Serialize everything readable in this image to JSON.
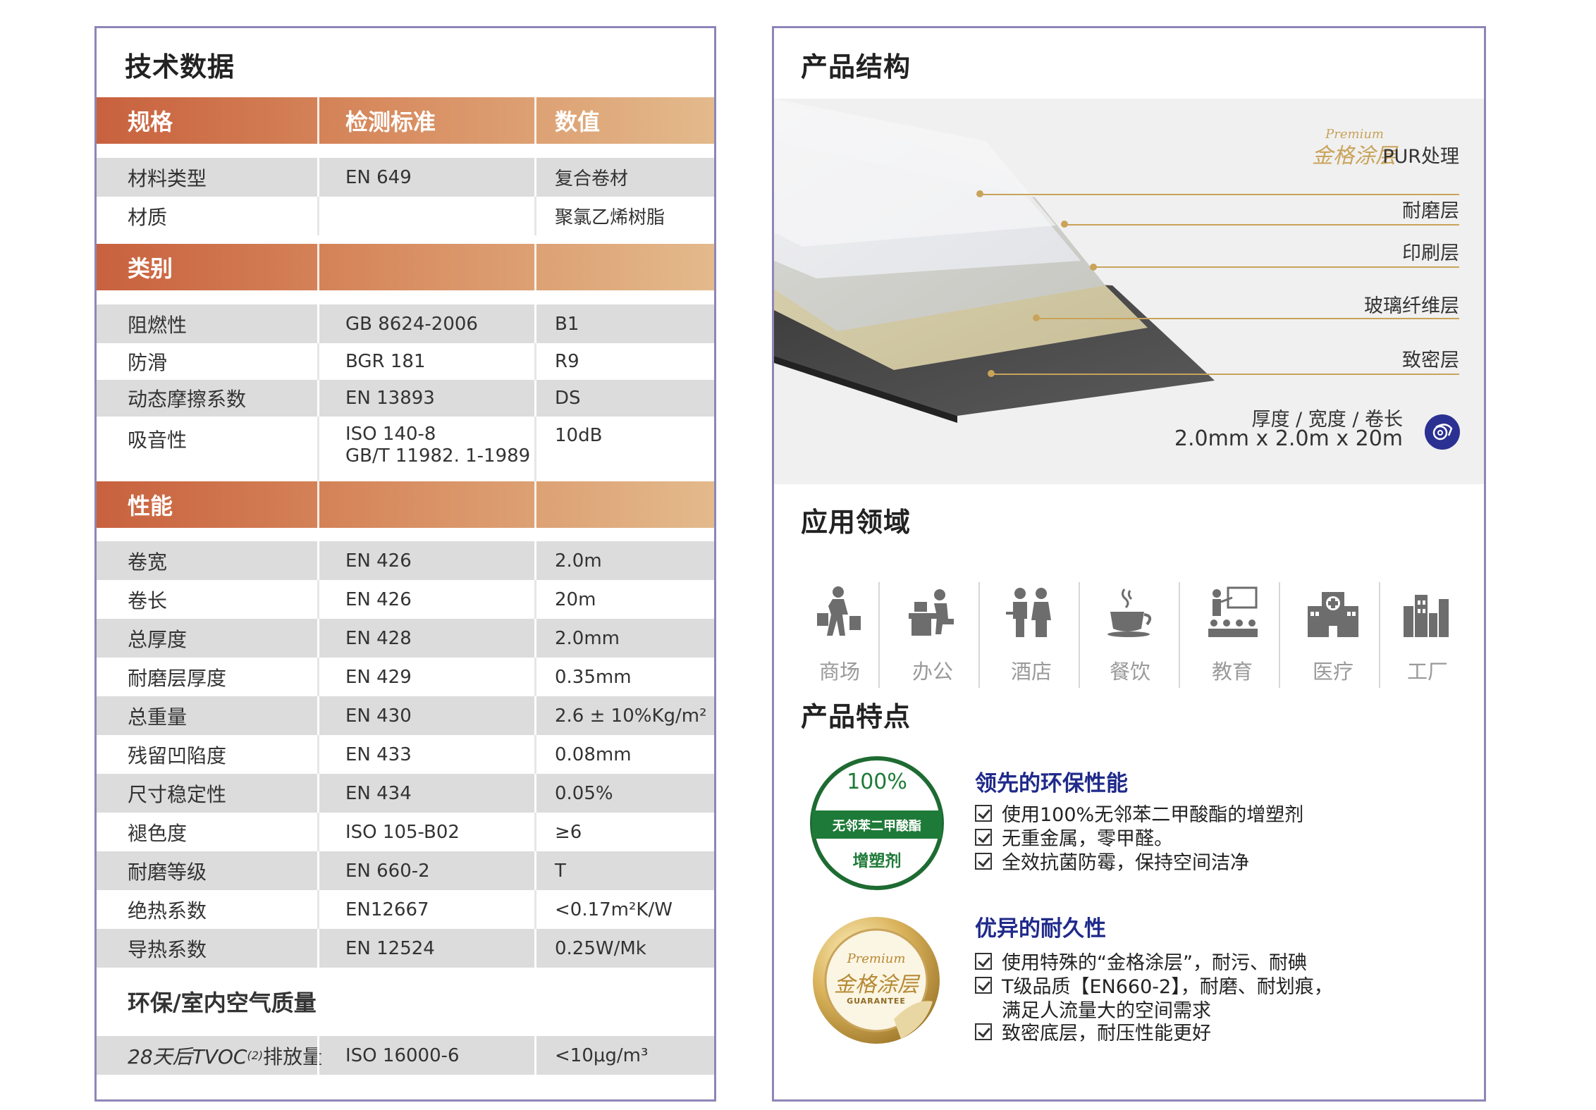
{
  "tech": {
    "title": "技术数据",
    "headers": {
      "spec": "规格",
      "standard": "检测标准",
      "value": "数值"
    },
    "group1": [
      {
        "name": "材料类型",
        "std": "EN 649",
        "val": "复合卷材"
      },
      {
        "name": "材质",
        "std": "",
        "val": "聚氯乙烯树脂"
      }
    ],
    "cat_label": "类别",
    "group2": [
      {
        "name": "阻燃性",
        "std": "GB 8624-2006",
        "val": "B1"
      },
      {
        "name": "防滑",
        "std": "BGR 181",
        "val": "R9"
      },
      {
        "name": "动态摩擦系数",
        "std": "EN 13893",
        "val": "DS"
      },
      {
        "name": "吸音性",
        "std": "ISO 140-8",
        "std2": "GB/T 11982. 1-1989",
        "val": "10dB"
      }
    ],
    "perf_label": "性能",
    "group3": [
      {
        "name": "卷宽",
        "std": "EN 426",
        "val": "2.0m"
      },
      {
        "name": "卷长",
        "std": "EN 426",
        "val": "20m"
      },
      {
        "name": "总厚度",
        "std": "EN 428",
        "val": "2.0mm"
      },
      {
        "name": "耐磨层厚度",
        "std": "EN 429",
        "val": "0.35mm"
      },
      {
        "name": "总重量",
        "std": "EN 430",
        "val": "2.6 ± 10%Kg/m²"
      },
      {
        "name": "残留凹陷度",
        "std": "EN 433",
        "val": "0.08mm"
      },
      {
        "name": "尺寸稳定性",
        "std": "EN 434",
        "val": "0.05%"
      },
      {
        "name": "褪色度",
        "std": "ISO 105-B02",
        "val": "≥6"
      },
      {
        "name": "耐磨等级",
        "std": "EN 660-2",
        "val": "T"
      },
      {
        "name": "绝热系数",
        "std": "EN12667",
        "val": "<0.17m²K/W"
      },
      {
        "name": "导热系数",
        "std": "EN 12524",
        "val": "0.25W/Mk"
      }
    ],
    "env_label": "环保/室内空气质量",
    "env_row": {
      "name_a": "28天后TVOC",
      "name_sub": "(2)",
      "name_b": "排放量",
      "std": "ISO 16000-6",
      "val": "<10μg/m³"
    }
  },
  "structure": {
    "title": "产品结构",
    "premium_script": "Premium",
    "premium_brand": "金格涂层",
    "pur": "PUR处理",
    "layers": [
      "耐磨层",
      "印刷层",
      "玻璃纤维层",
      "致密层"
    ],
    "dims_label": "厚度 / 宽度 / 卷长",
    "dims_value": "2.0mm x 2.0m x 20m"
  },
  "applications": {
    "title": "应用领域",
    "items": [
      "商场",
      "办公",
      "酒店",
      "餐饮",
      "教育",
      "医疗",
      "工厂"
    ]
  },
  "features": {
    "title": "产品特点",
    "badge1": {
      "pct": "100%",
      "band": "无邻苯二甲酸酯",
      "bottom": "增塑剂"
    },
    "badge2": {
      "script": "Premium",
      "brand": "金格涂层",
      "ribbon": "GUARANTEE"
    },
    "f1_title": "领先的环保性能",
    "f1_lines": [
      "使用100%无邻苯二甲酸酯的增塑剂",
      "无重金属，零甲醛。",
      "全效抗菌防霉，保持空间洁净"
    ],
    "f2_title": "优异的耐久性",
    "f2_lines": [
      "使用特殊的“金格涂层”，耐污、耐碘",
      "T级品质【EN660-2】，耐磨、耐划痕，",
      "致密底层，耐压性能更好"
    ],
    "f2_cont": "满足人流量大的空间需求"
  },
  "colors": {
    "accent_orange": "#c8613e",
    "accent_gold": "#c9a35a",
    "feature_blue": "#1f2a8a",
    "frame": "#8e86b8"
  }
}
